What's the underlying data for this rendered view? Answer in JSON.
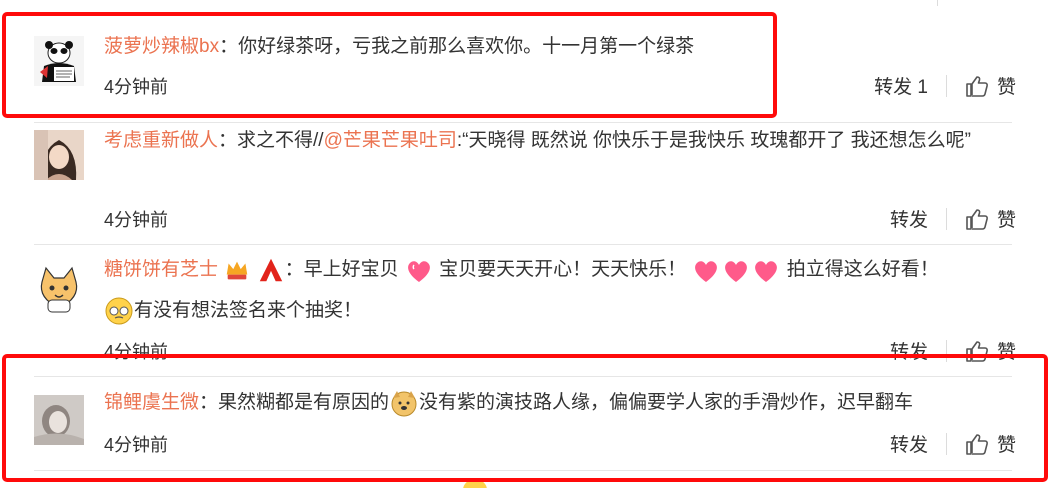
{
  "comments": [
    {
      "user": "菠萝炒辣椒bx",
      "text": "：你好绿茶呀，亏我之前那么喜欢你。十一月第一个绿茶",
      "time": "4分钟前",
      "repost": "转发 1",
      "like": "赞"
    },
    {
      "user": "考虑重新做人",
      "text_before": "：求之不得//",
      "mention": "@芒果芒果吐司",
      "text_after": ":“天晓得 既然说 你快乐于是我快乐 玫瑰都开了 我还想怎么呢”",
      "time": "4分钟前",
      "repost": "转发",
      "like": "赞"
    },
    {
      "user": "糖饼饼有芝士",
      "text_a": "：早上好宝贝",
      "text_b": " 宝贝要天天开心！天天快乐！",
      "text_c": " 拍立得这么好看！",
      "text_d": "有没有想法签名来个抽奖！",
      "time": "4分钟前",
      "repost": "转发",
      "like": "赞"
    },
    {
      "user": "锦鲤虞生微",
      "text_a": "：果然糊都是有原因的",
      "text_b": "没有紫的演技路人缘，偏偏要学人家的手滑炒作，迟早翻车",
      "time": "4分钟前",
      "repost": "转发",
      "like": "赞"
    }
  ],
  "colors": {
    "username": "#eb7350",
    "highlight_box": "#ff0a0a"
  },
  "icons": [
    "thumbs-up-icon",
    "heart-emoji-icon",
    "crown-badge-icon",
    "red-a-badge-icon",
    "ok-dog-emoji-icon",
    "sweat-emoji-icon"
  ]
}
